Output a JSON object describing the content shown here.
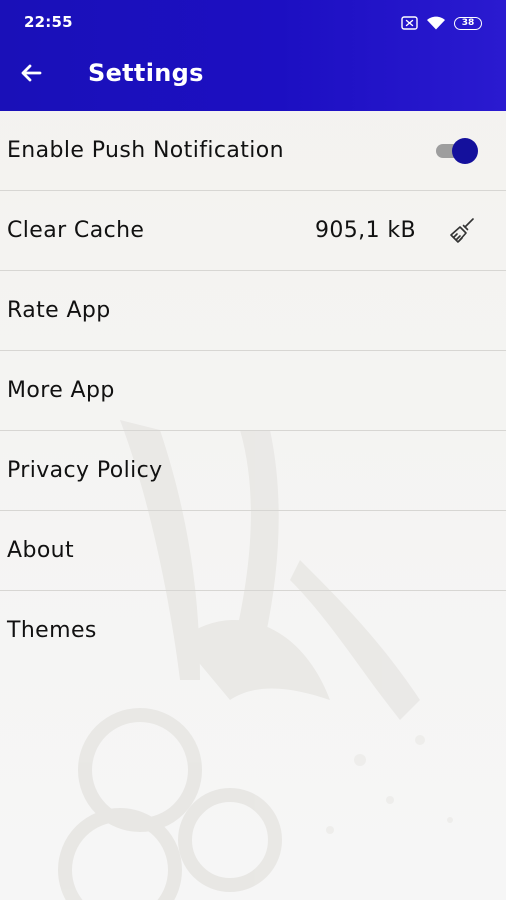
{
  "status_bar": {
    "time": "22:55",
    "battery_level": "38",
    "icons": [
      "sim-icon",
      "wifi-icon",
      "battery-icon"
    ]
  },
  "app_bar": {
    "title": "Settings",
    "back_icon": "arrow-left-icon"
  },
  "settings": [
    {
      "label": "Enable Push Notification",
      "control": "toggle",
      "enabled": true
    },
    {
      "label": "Clear Cache",
      "value": "905,1 kB",
      "icon": "broom-icon"
    },
    {
      "label": "Rate App"
    },
    {
      "label": "More App"
    },
    {
      "label": "Privacy Policy"
    },
    {
      "label": "About"
    },
    {
      "label": "Themes"
    }
  ],
  "colors": {
    "app_bar": "#1c0fc2",
    "background": "#f3f2ef",
    "divider": "#d7d6d3",
    "toggle_thumb": "#14109c",
    "toggle_track": "#9e9e9e",
    "text": "#111111"
  }
}
